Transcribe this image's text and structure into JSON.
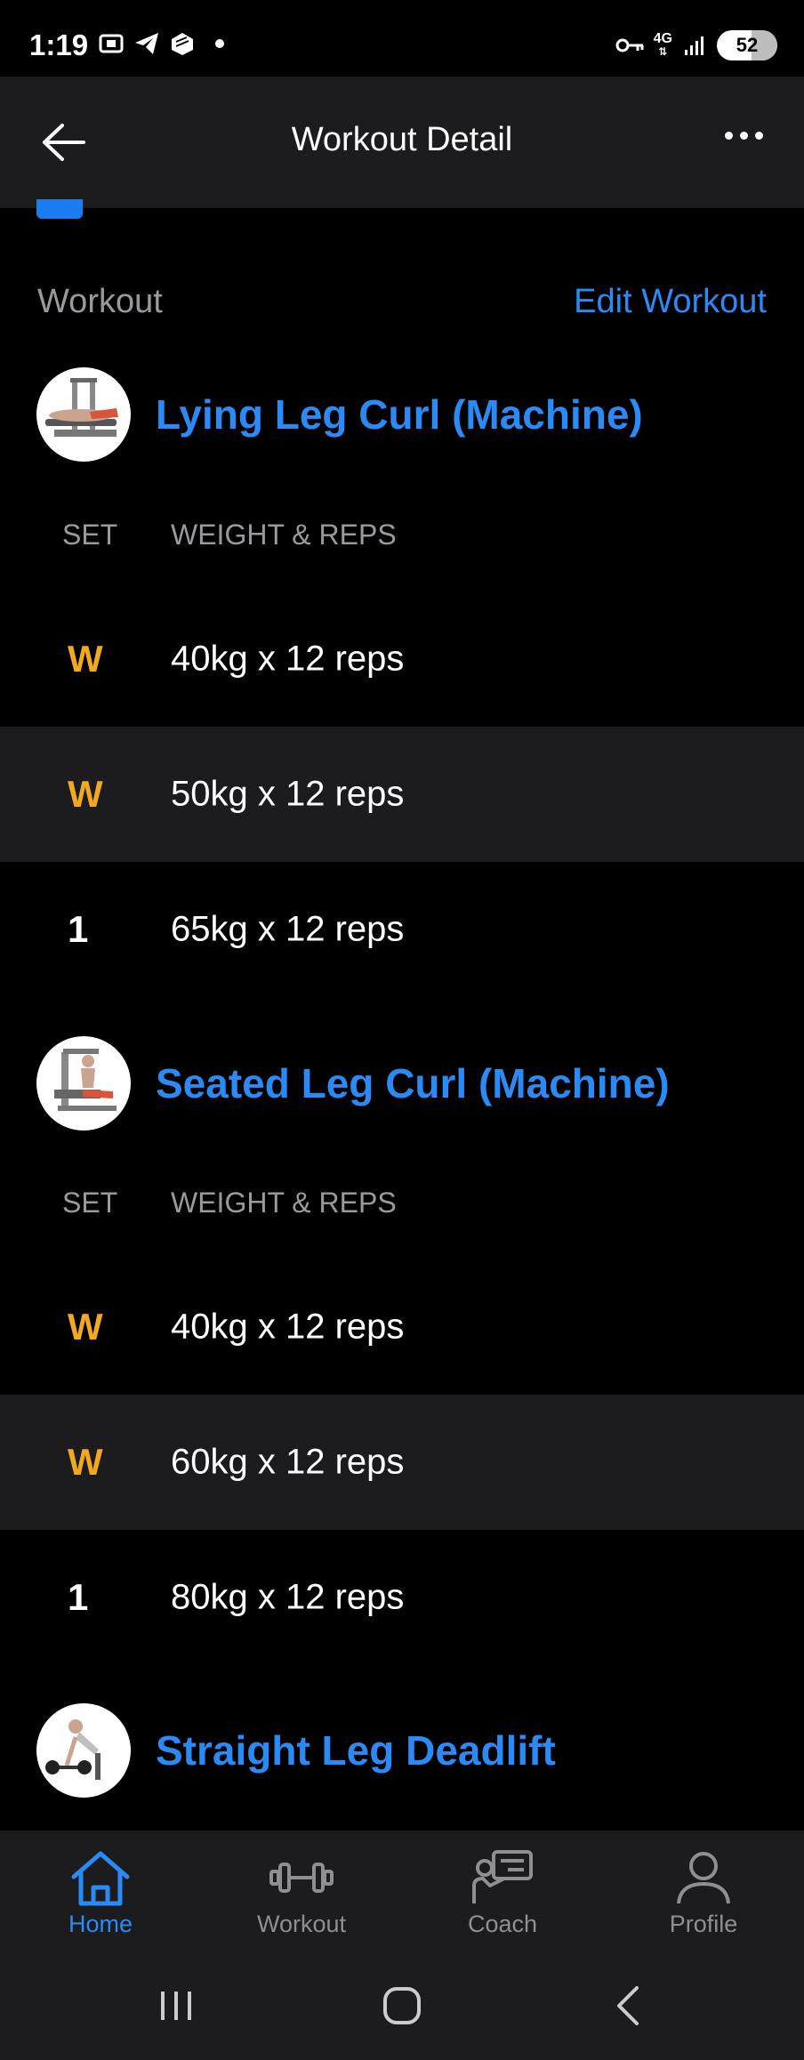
{
  "status_bar": {
    "time": "1:19",
    "network": "4G",
    "battery": "52"
  },
  "app_bar": {
    "title": "Workout Detail"
  },
  "workout_section": {
    "label": "Workout",
    "edit_label": "Edit Workout"
  },
  "column_headers": {
    "set": "SET",
    "weight_reps": "WEIGHT & REPS"
  },
  "exercises": [
    {
      "name": "Lying Leg Curl (Machine)",
      "sets": [
        {
          "set": "W",
          "type": "warmup",
          "value": "40kg x 12 reps"
        },
        {
          "set": "W",
          "type": "warmup",
          "value": "50kg x 12 reps"
        },
        {
          "set": "1",
          "type": "normal",
          "value": "65kg x 12 reps"
        }
      ]
    },
    {
      "name": "Seated Leg Curl (Machine)",
      "sets": [
        {
          "set": "W",
          "type": "warmup",
          "value": "40kg x 12 reps"
        },
        {
          "set": "W",
          "type": "warmup",
          "value": "60kg x 12 reps"
        },
        {
          "set": "1",
          "type": "normal",
          "value": "80kg x 12 reps"
        }
      ]
    },
    {
      "name": "Straight Leg Deadlift",
      "sets": []
    }
  ],
  "bottom_nav": [
    {
      "label": "Home",
      "icon": "home-icon",
      "active": true
    },
    {
      "label": "Workout",
      "icon": "dumbbell-icon",
      "active": false
    },
    {
      "label": "Coach",
      "icon": "coach-icon",
      "active": false
    },
    {
      "label": "Profile",
      "icon": "profile-icon",
      "active": false
    }
  ],
  "colors": {
    "accent": "#2a8af6",
    "warmup": "#f2a91f",
    "surface": "#1c1c1e",
    "background": "#000000"
  }
}
